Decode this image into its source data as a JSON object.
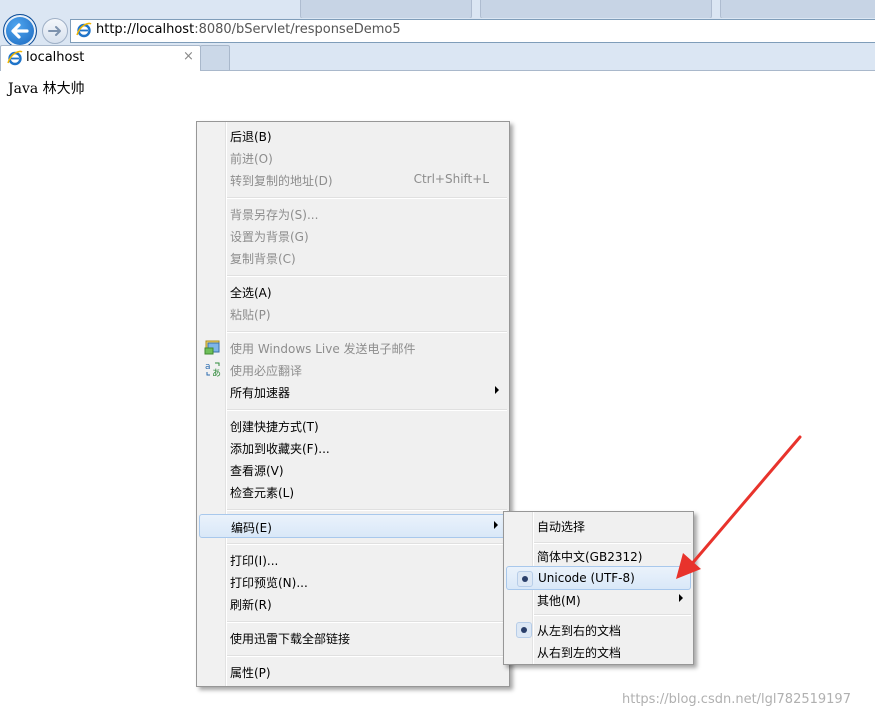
{
  "browser": {
    "url": "http://localhost:8080/bServlet/responseDemo5",
    "url_host": "http://localhost",
    "url_rest": ":8080/bServlet/responseDemo5",
    "tab_title": "localhost",
    "tab_close": "×"
  },
  "page": {
    "body_text": "Java 林大帅"
  },
  "context_menu": {
    "items": [
      {
        "label": "后退(B)"
      },
      {
        "label": "前进(O)"
      },
      {
        "label": "转到复制的地址(D)",
        "shortcut": "Ctrl+Shift+L"
      },
      {
        "label": "背景另存为(S)..."
      },
      {
        "label": "设置为背景(G)"
      },
      {
        "label": "复制背景(C)"
      },
      {
        "label": "全选(A)"
      },
      {
        "label": "粘贴(P)"
      },
      {
        "label": "使用 Windows Live 发送电子邮件"
      },
      {
        "label": "使用必应翻译"
      },
      {
        "label": "所有加速器"
      },
      {
        "label": "创建快捷方式(T)"
      },
      {
        "label": "添加到收藏夹(F)..."
      },
      {
        "label": "查看源(V)"
      },
      {
        "label": "检查元素(L)"
      },
      {
        "label": "编码(E)"
      },
      {
        "label": "打印(I)..."
      },
      {
        "label": "打印预览(N)..."
      },
      {
        "label": "刷新(R)"
      },
      {
        "label": "使用迅雷下载全部链接"
      },
      {
        "label": "属性(P)"
      }
    ]
  },
  "encoding_menu": {
    "items": [
      {
        "label": "自动选择"
      },
      {
        "label": "简体中文(GB2312)"
      },
      {
        "label": "Unicode (UTF-8)",
        "checked": true
      },
      {
        "label": "其他(M)"
      },
      {
        "label": "从左到右的文档",
        "checked": true
      },
      {
        "label": "从右到左的文档"
      }
    ]
  },
  "watermark": "https://blog.csdn.net/lgl782519197",
  "colors": {
    "annotation_arrow": "#e8332c",
    "menu_background": "#f0f0f0",
    "highlight": "#d9e8f8"
  }
}
